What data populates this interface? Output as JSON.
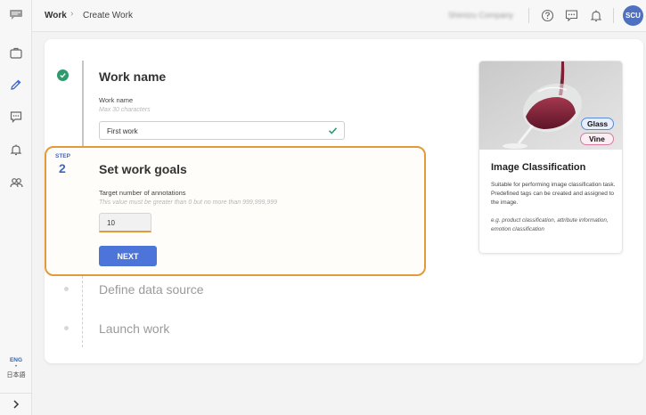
{
  "breadcrumb": {
    "root": "Work",
    "separator": "›",
    "current": "Create Work"
  },
  "header": {
    "company": "Shimizu Company",
    "avatar_initials": "SCU"
  },
  "sidebar": {
    "lang_active": "ENG",
    "lang_dot": "•",
    "lang_alt": "日本語"
  },
  "steps": {
    "work_name": {
      "title": "Work name",
      "field_label": "Work name",
      "field_hint": "Max 30 characters",
      "field_value": "First work"
    },
    "work_goals": {
      "step_label": "STEP",
      "step_number": "2",
      "title": "Set work goals",
      "field_label": "Target number of annotations",
      "field_hint": "This value must be greater than 0 but no more than 999,999,999",
      "field_value": "10",
      "next_button": "NEXT"
    },
    "data_source": {
      "title": "Define data source"
    },
    "launch": {
      "title": "Launch work"
    }
  },
  "info_card": {
    "title": "Image Classification",
    "tags": [
      "Glass",
      "Vine"
    ],
    "description": "Suitable for performing image classification task. Predefined tags can be created and assigned to the image.",
    "examples": "e.g. product classification, attribute information, emotion classification"
  },
  "colors": {
    "accent": "#4c74d9",
    "highlight": "#e39a3a",
    "success": "#2e9a6d"
  }
}
